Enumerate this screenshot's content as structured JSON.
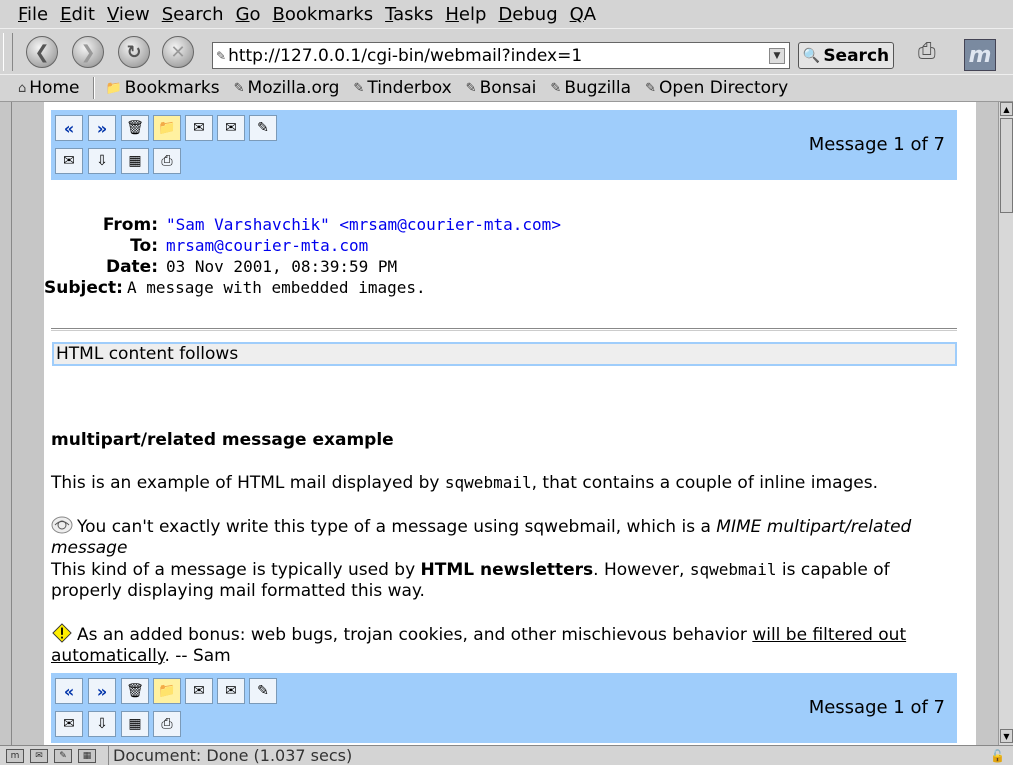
{
  "menu": {
    "items": [
      {
        "key": "F",
        "rest": "ile"
      },
      {
        "key": "E",
        "rest": "dit"
      },
      {
        "key": "V",
        "rest": "iew"
      },
      {
        "key": "S",
        "rest": "earch"
      },
      {
        "key": "G",
        "rest": "o"
      },
      {
        "key": "B",
        "rest": "ookmarks"
      },
      {
        "key": "T",
        "rest": "asks"
      },
      {
        "key": "H",
        "rest": "elp"
      },
      {
        "key": "D",
        "rest": "ebug"
      },
      {
        "key": "Q",
        "rest": "A"
      }
    ]
  },
  "nav": {
    "url": "http://127.0.0.1/cgi-bin/webmail?index=1",
    "search_label": "Search"
  },
  "bookmarks": {
    "home": "Home",
    "items": [
      "Bookmarks",
      "Mozilla.org",
      "Tinderbox",
      "Bonsai",
      "Bugzilla",
      "Open Directory"
    ]
  },
  "message": {
    "counter": "Message 1 of 7",
    "headers": {
      "from_label": "From:",
      "from_value": "\"Sam Varshavchik\" <mrsam@courier-mta.com>",
      "to_label": "To:",
      "to_value": "mrsam@courier-mta.com",
      "date_label": "Date:",
      "date_value": "03 Nov 2001, 08:39:59 PM",
      "subject_label": "Subject:",
      "subject_value": "A message with embedded images."
    },
    "html_banner": "HTML content follows",
    "body": {
      "heading": "multipart/related message example",
      "p1_a": "This is an example of HTML mail displayed by ",
      "p1_code": "sqwebmail",
      "p1_b": ", that contains a couple of inline images.",
      "p2_a": "You can't exactly write this type of a message using sqwebmail, which is a ",
      "p2_em": "MIME multipart/related message",
      "p2_b": "This kind of a message is typically used by ",
      "p2_strong": "HTML newsletters",
      "p2_c": ". However, ",
      "p2_code": "sqwebmail",
      "p2_d": " is capable of properly displaying mail formatted this way.",
      "p3_a": "As an added bonus: web bugs, trojan cookies, and other mischievous behavior ",
      "p3_link": "will be filtered out automatically",
      "p3_b": ". -- Sam"
    }
  },
  "status": {
    "text": "Document: Done (1.037 secs)"
  },
  "colors": {
    "toolbar_bg": "#9fcdfb",
    "link": "#0000ee"
  }
}
